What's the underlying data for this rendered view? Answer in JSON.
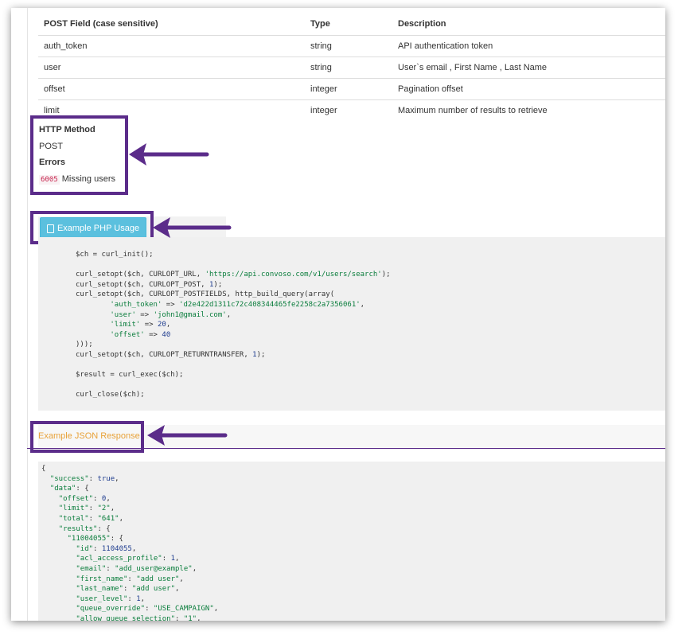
{
  "table": {
    "headers": [
      "POST Field (case sensitive)",
      "Type",
      "Description"
    ],
    "rows": [
      {
        "field": "auth_token",
        "type": "string",
        "description": "API authentication token"
      },
      {
        "field": "user",
        "type": "string",
        "description": "User`s email , First Name , Last Name"
      },
      {
        "field": "offset",
        "type": "integer",
        "description": "Pagination offset"
      },
      {
        "field": "limit",
        "type": "integer",
        "description": "Maximum number of results to retrieve"
      }
    ]
  },
  "http_method": {
    "label": "HTTP Method",
    "value": "POST"
  },
  "errors": {
    "label": "Errors",
    "code": "6005",
    "message": "Missing users"
  },
  "php_example": {
    "button_label": "Example PHP Usage",
    "icon": "file-icon",
    "code_lines": [
      "$ch = curl_init();",
      "",
      "curl_setopt($ch, CURLOPT_URL, 'https://api.convoso.com/v1/users/search');",
      "curl_setopt($ch, CURLOPT_POST, 1);",
      "curl_setopt($ch, CURLOPT_POSTFIELDS, http_build_query(array(",
      "        'auth_token' => 'd2e422d1311c72c408344465fe2258c2a7356061',",
      "        'user' => 'john1@gmail.com',",
      "        'limit' => 20,",
      "        'offset' => 40",
      ")));",
      "curl_setopt($ch, CURLOPT_RETURNTRANSFER, 1);",
      "",
      "$result = curl_exec($ch);",
      "",
      "curl_close($ch);"
    ]
  },
  "json_example": {
    "title": "Example JSON Response",
    "code_lines": [
      "{",
      "  \"success\": true,",
      "  \"data\": {",
      "    \"offset\": 0,",
      "    \"limit\": \"2\",",
      "    \"total\": \"641\",",
      "    \"results\": {",
      "      \"11004055\": {",
      "        \"id\": 1104055,",
      "        \"acl_access_profile\": 1,",
      "        \"email\": \"add_user@example\",",
      "        \"first_name\": \"add user\",",
      "        \"last_name\": \"add user\",",
      "        \"user_level\": 1,",
      "        \"queue_override\": \"USE_CAMPAIGN\",",
      "        \"allow_queue_selection\": \"1\","
    ]
  },
  "colors": {
    "highlight": "#5b2c8a",
    "button": "#5bc0de",
    "json_title": "#e8a23a",
    "error_code": "#c7254e"
  }
}
